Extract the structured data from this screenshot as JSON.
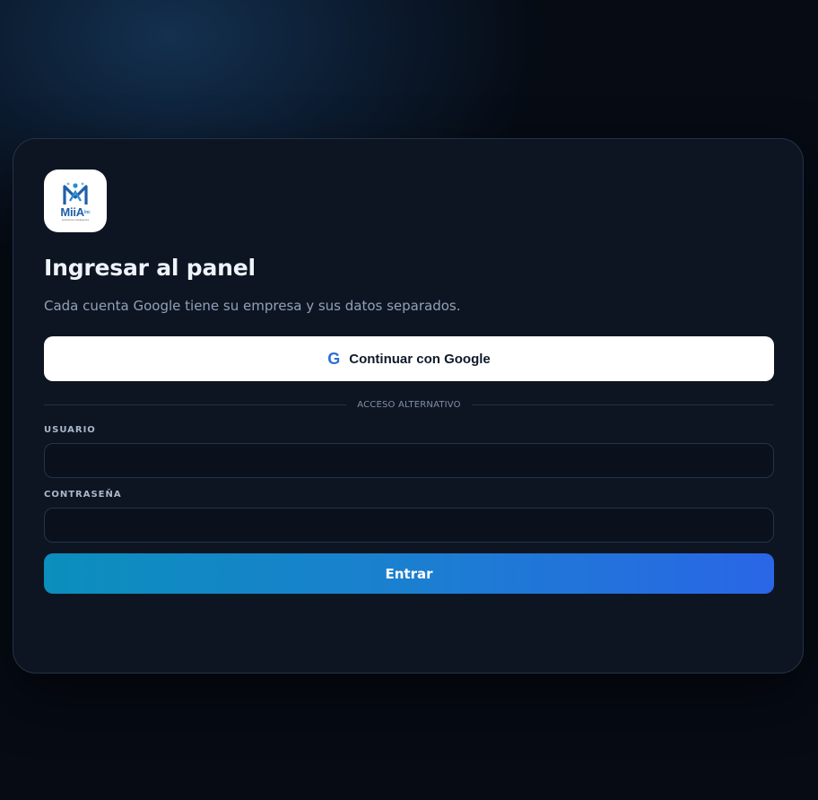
{
  "logo": {
    "brand": "MiiA",
    "suffix": "Inc",
    "tagline": "soluciones inteligentes"
  },
  "login": {
    "title": "Ingresar al panel",
    "subtitle": "Cada cuenta Google tiene su empresa y sus datos separados.",
    "google_button_label": "Continuar con Google",
    "google_icon_glyph": "G",
    "divider_text": "ACCESO ALTERNATIVO",
    "username_label": "USUARIO",
    "username_value": "",
    "password_label": "CONTRASEÑA",
    "password_value": "",
    "submit_label": "Entrar"
  },
  "colors": {
    "background": "#060b14",
    "card": "#0e1522",
    "accent_start": "#0b8fbc",
    "accent_end": "#2a66e6",
    "google_icon": "#2d6fd6"
  },
  "icons": {
    "logo": "miia-logo-icon",
    "google": "google-icon"
  }
}
